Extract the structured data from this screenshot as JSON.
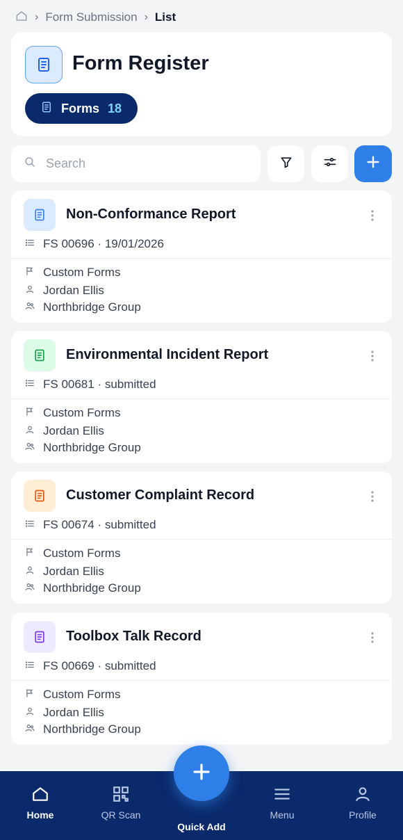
{
  "breadcrumb": {
    "parent": "Form Submission",
    "current": "List"
  },
  "header": {
    "title": "Form Register",
    "forms_label": "Forms",
    "forms_count": "18"
  },
  "search": {
    "placeholder": "Search"
  },
  "cards": [
    {
      "title": "Non-Conformance Report",
      "meta": "FS 00696 · 19/01/2026",
      "category": "Custom Forms",
      "person": "Jordan Ellis",
      "group": "Northbridge Group",
      "icon_color": "#3b82f6",
      "icon_bg": "#dbeafe"
    },
    {
      "title": "Environmental Incident Report",
      "meta": "FS 00681 · submitted",
      "category": "Custom Forms",
      "person": "Jordan Ellis",
      "group": "Northbridge Group",
      "icon_color": "#16a34a",
      "icon_bg": "#dcfce7"
    },
    {
      "title": "Customer Complaint Record",
      "meta": "FS 00674 · submitted",
      "category": "Custom Forms",
      "person": "Jordan Ellis",
      "group": "Northbridge Group",
      "icon_color": "#ea580c",
      "icon_bg": "#ffedd5"
    },
    {
      "title": "Toolbox Talk Record",
      "meta": "FS 00669 · submitted",
      "category": "Custom Forms",
      "person": "Jordan Ellis",
      "group": "Northbridge Group",
      "icon_color": "#7c3aed",
      "icon_bg": "#ede9fe"
    }
  ],
  "nav": {
    "home": "Home",
    "qr": "QR Scan",
    "quick_add": "Quick Add",
    "menu": "Menu",
    "profile": "Profile"
  },
  "colors": {
    "accent": "#2f7fe8",
    "nav_bg": "#0b2a6b",
    "count": "#7dd3fc"
  }
}
